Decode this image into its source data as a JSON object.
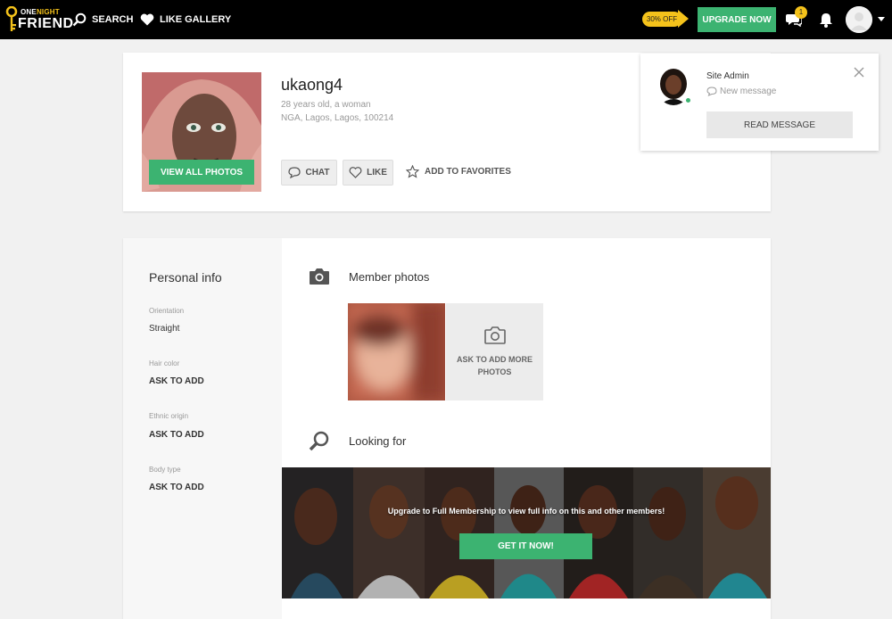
{
  "brand": {
    "line1_a": "ONE",
    "line1_b": "NIGHT",
    "line2": "FRIEND"
  },
  "nav": {
    "search": "SEARCH",
    "like_gallery": "LIKE GALLERY"
  },
  "promo": {
    "discount": "30% OFF",
    "upgrade": "UPGRADE NOW"
  },
  "header": {
    "messages_count": "1"
  },
  "profile": {
    "username": "ukaong4",
    "age_gender": "28 years old, a woman",
    "location": "NGA, Lagos, Lagos, 100214",
    "view_all_photos": "VIEW ALL PHOTOS",
    "chat": "CHAT",
    "like": "LIKE",
    "favorites": "ADD TO FAVORITES"
  },
  "notification": {
    "sender": "Site Admin",
    "message": "New message",
    "read_button": "READ MESSAGE"
  },
  "personal_info": {
    "title": "Personal info",
    "fields": [
      {
        "label": "Orientation",
        "value": "Straight"
      },
      {
        "label": "Hair color",
        "value": "ASK TO ADD"
      },
      {
        "label": "Ethnic origin",
        "value": "ASK TO ADD"
      },
      {
        "label": "Body type",
        "value": "ASK TO ADD"
      }
    ]
  },
  "member_photos": {
    "title": "Member photos",
    "ask_more_line1": "ASK TO ADD MORE",
    "ask_more_line2": "PHOTOS"
  },
  "looking_for": {
    "title": "Looking for",
    "banner_text": "Upgrade to Full Membership to view full info on this and other members!",
    "cta": "GET IT NOW!"
  },
  "colors": {
    "accent": "#3cb371",
    "promo": "#f4c21b",
    "topbar": "#000000"
  }
}
